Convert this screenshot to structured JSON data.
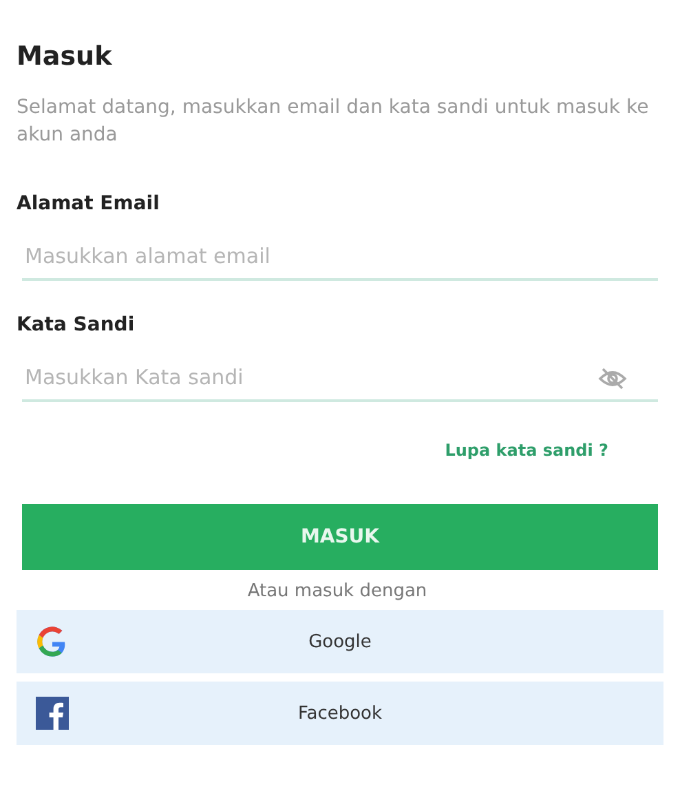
{
  "title": "Masuk",
  "subtitle": "Selamat datang, masukkan email dan kata sandi untuk masuk ke akun anda",
  "fields": [
    {
      "label": "Alamat Email",
      "placeholder": "Masukkan alamat email",
      "kind": "email"
    },
    {
      "label": "Kata Sandi",
      "placeholder": "Masukkan Kata sandi",
      "kind": "password"
    }
  ],
  "forgot_link": "Lupa kata sandi ?",
  "submit_button": "MASUK",
  "alt_text": "Atau masuk dengan",
  "social_buttons": [
    {
      "label": "Google",
      "kind": "google"
    },
    {
      "label": "Facebook",
      "kind": "facebook"
    }
  ]
}
